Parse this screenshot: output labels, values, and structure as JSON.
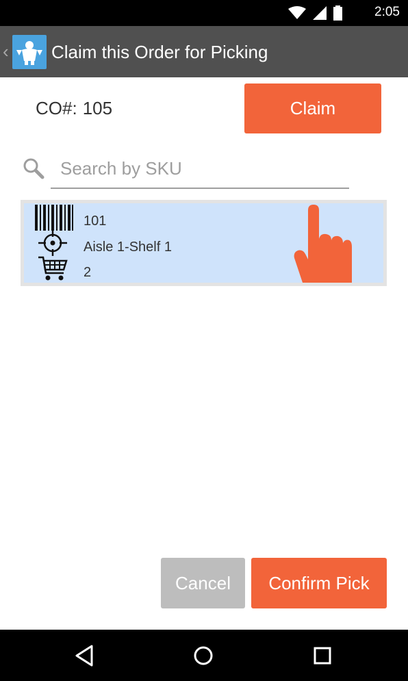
{
  "status_bar": {
    "time": "2:05",
    "icons": [
      "wifi-icon",
      "cellular-signal-icon",
      "battery-icon"
    ]
  },
  "action_bar": {
    "title": "Claim this Order for Picking",
    "back_icon": "chevron-left-icon",
    "app_icon": "app-logo-icon"
  },
  "order": {
    "label": "CO#:",
    "number": "105"
  },
  "buttons": {
    "claim": "Claim",
    "cancel": "Cancel",
    "confirm": "Confirm Pick"
  },
  "search": {
    "placeholder": "Search by SKU",
    "value": ""
  },
  "items": [
    {
      "sku": "101",
      "location": "Aisle 1-Shelf 1",
      "quantity": "2"
    }
  ],
  "colors": {
    "accent": "#f2643a",
    "action_bar": "#505050",
    "item_bg": "#cfe3fb",
    "cancel_bg": "#bdbdbd"
  },
  "nav_bar": {
    "icons": [
      "back-triangle-icon",
      "home-circle-icon",
      "recents-square-icon"
    ]
  }
}
